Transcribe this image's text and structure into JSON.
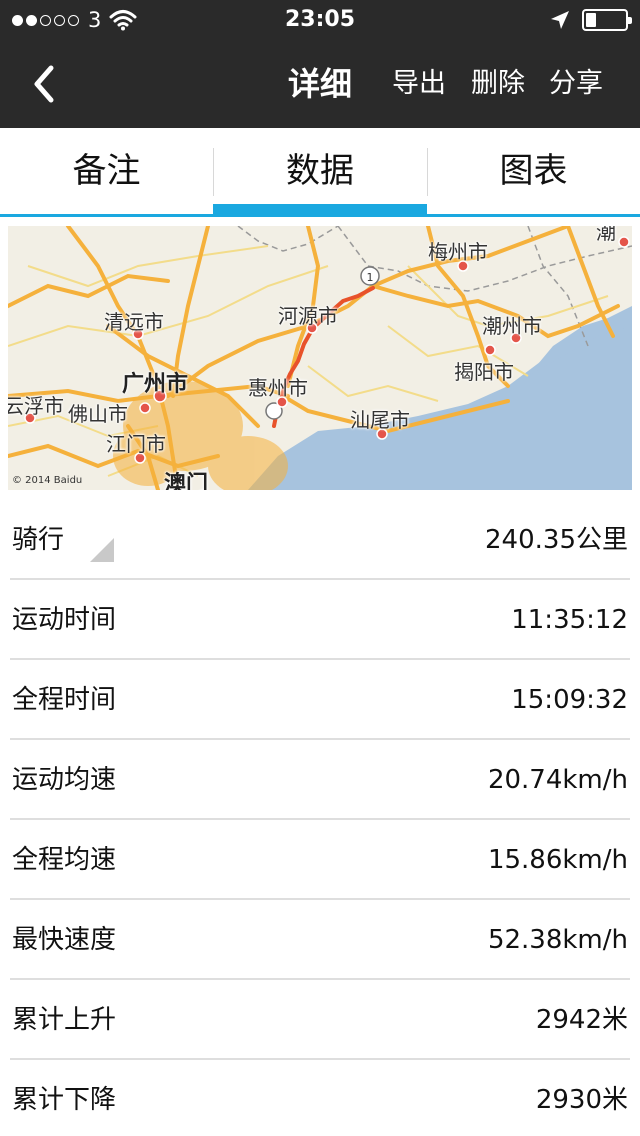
{
  "status_bar": {
    "carrier": "3",
    "time": "23:05",
    "signal_icon": "signal-dots-icon",
    "wifi_icon": "wifi-icon",
    "location_icon": "location-arrow-icon",
    "battery_icon": "battery-icon",
    "battery_level": 0.25
  },
  "nav": {
    "title": "详细",
    "export_label": "导出",
    "delete_label": "删除",
    "share_label": "分享",
    "back_icon": "chevron-left-icon"
  },
  "tabs": [
    {
      "label": "备注",
      "active": false
    },
    {
      "label": "数据",
      "active": true
    },
    {
      "label": "图表",
      "active": false
    }
  ],
  "map": {
    "labels": [
      "梅州市",
      "清远市",
      "河源市",
      "潮州市",
      "揭阳市",
      "广州市",
      "惠州市",
      "云浮市",
      "佛山市",
      "汕尾市",
      "江门市",
      "澳门",
      "潮"
    ],
    "copyright": "© 2014 Baidu",
    "route_color": "#e8522a",
    "sea_color": "#a7c3de",
    "road_color": "#f5b13c"
  },
  "stats": [
    {
      "label": "骑行",
      "value": "240.35公里",
      "selector": true
    },
    {
      "label": "运动时间",
      "value": "11:35:12"
    },
    {
      "label": "全程时间",
      "value": "15:09:32"
    },
    {
      "label": "运动均速",
      "value": "20.74km/h"
    },
    {
      "label": "全程均速",
      "value": "15.86km/h"
    },
    {
      "label": "最快速度",
      "value": "52.38km/h"
    },
    {
      "label": "累计上升",
      "value": "2942米"
    },
    {
      "label": "累计下降",
      "value": "2930米"
    }
  ],
  "colors": {
    "bar_bg": "#2a2a2a",
    "accent": "#1aa8e0"
  }
}
